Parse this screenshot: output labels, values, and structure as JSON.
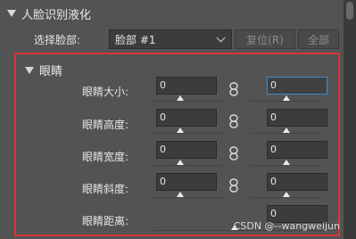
{
  "section": {
    "title": "人脸识别液化"
  },
  "face_select": {
    "label": "选择脸部:",
    "value": "脸部 #1"
  },
  "buttons": {
    "reset": "复位(R)",
    "all": "全部"
  },
  "eyes": {
    "title": "眼睛",
    "rows": [
      {
        "label": "眼睛大小:",
        "left": "0",
        "right": "0"
      },
      {
        "label": "眼睛高度:",
        "left": "0",
        "right": "0"
      },
      {
        "label": "眼睛宽度:",
        "left": "0",
        "right": "0"
      },
      {
        "label": "眼睛斜度:",
        "left": "0",
        "right": "0"
      },
      {
        "label": "眼睛距离:",
        "single": "0"
      }
    ]
  },
  "watermark": "CSDN @--wangweijun"
}
